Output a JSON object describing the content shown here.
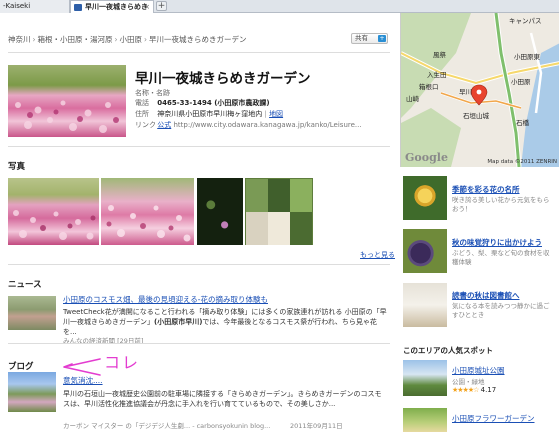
{
  "browser": {
    "tabs": [
      {
        "label": "-Kaiseki"
      },
      {
        "label": "早川一夜城きらめき",
        "close": "×"
      }
    ],
    "new_tab": "+"
  },
  "breadcrumb": [
    "神奈川",
    "箱根・小田原・湯河原",
    "小田原",
    "早川一夜城きらめきガーデン"
  ],
  "breadcrumb_sep": "›",
  "share": {
    "label": "共有",
    "icon": "plus-icon"
  },
  "place": {
    "title": "早川一夜城きらめきガーデン",
    "name_label": "名称・名跡",
    "phone_label": "電話",
    "phone": "0465-33-1494 (小田原市農政課)",
    "address_label": "住所",
    "address": "神奈川県小田原市早川梅ヶ窪地内",
    "map_link": "地図",
    "link_label": "リンク",
    "official_link": "公式",
    "url": "http://www.city.odawara.kanagawa.jp/kanko/Leisure..."
  },
  "sections": {
    "photos": "写真",
    "news": "ニュース",
    "blog": "ブログ"
  },
  "more_link": "もっと見る",
  "news": {
    "title": "小田原のコスモス畑、最後の見頃迎える-花の摘み取り体験も",
    "body_pre": "TweetCheck花が満開になること行われる「摘み取り体験」には多くの家族連れが訪れる 小田原の「早川一夜城きらめきガーデン」",
    "body_bold": "(小田原市早川)",
    "body_post": "では、今年最後となるコスモス祭が行われ、ちら見ゃ花を...",
    "source": "みんなの経済新聞",
    "age": "[29日前]"
  },
  "annotation": {
    "text": "コレ",
    "color": "#e33cd0"
  },
  "blog": {
    "title": "意気消沈....",
    "body": "早川の石垣山一夜城歴史公園前の駐車場に隣接する「きらめきガーデン」。きらめきガーデンのコスモスは、早川活性化推進協議会が丹念に手入れを行い育てているもので、その美しさか...",
    "source": "カーボン マイスター の「デジデジ人生劇... - carbonsyokunin blog...",
    "date": "2011年09月11日"
  },
  "map": {
    "labels": [
      "風祭",
      "入生田",
      "小田原",
      "箱根口",
      "山崎",
      "早川",
      "石垣山城",
      "石橋",
      "小田原東",
      "キャンパス"
    ],
    "copyright": "Map data ©2011 ZENRIN",
    "logo": "Google",
    "marker_icon": "map-pin-icon",
    "accent": "#e8442e"
  },
  "promos": [
    {
      "title": "季節を彩る花の名所",
      "desc": "咲き誇る美しい花から元気をもらおう！"
    },
    {
      "title": "秋の味覚狩りに出かけよう",
      "desc": "ぶどう、梨、栗など旬の食材を収穫体験"
    },
    {
      "title": "読書の秋は図書館へ",
      "desc": "気になる本を読みつつ静かに過ごすひととき"
    }
  ],
  "popular": {
    "heading": "このエリアの人気スポット",
    "items": [
      {
        "title": "小田原城址公園",
        "category": "公園・緑地",
        "stars": "★★★★☆",
        "rating": "4.17"
      },
      {
        "title": "小田原フラワーガーデン"
      }
    ]
  }
}
